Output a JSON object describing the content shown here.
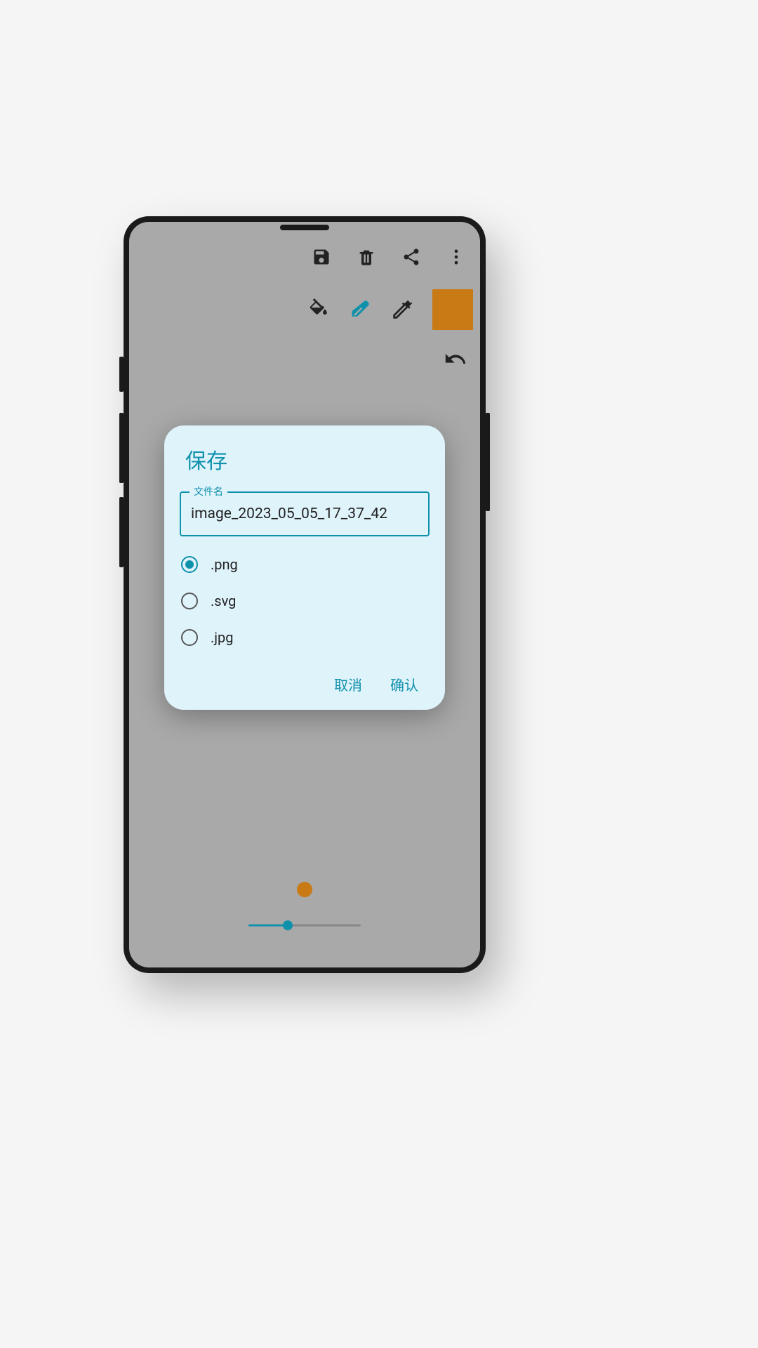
{
  "dialog": {
    "title": "保存",
    "filename_label": "文件名",
    "filename_value": "image_2023_05_05_17_37_42",
    "formats": [
      {
        "label": ".png",
        "selected": true
      },
      {
        "label": ".svg",
        "selected": false
      },
      {
        "label": ".jpg",
        "selected": false
      }
    ],
    "cancel": "取消",
    "confirm": "确认"
  },
  "colors": {
    "accent": "#0f91ac",
    "swatch": "#c97a14"
  },
  "slider": {
    "value_percent": 35
  }
}
